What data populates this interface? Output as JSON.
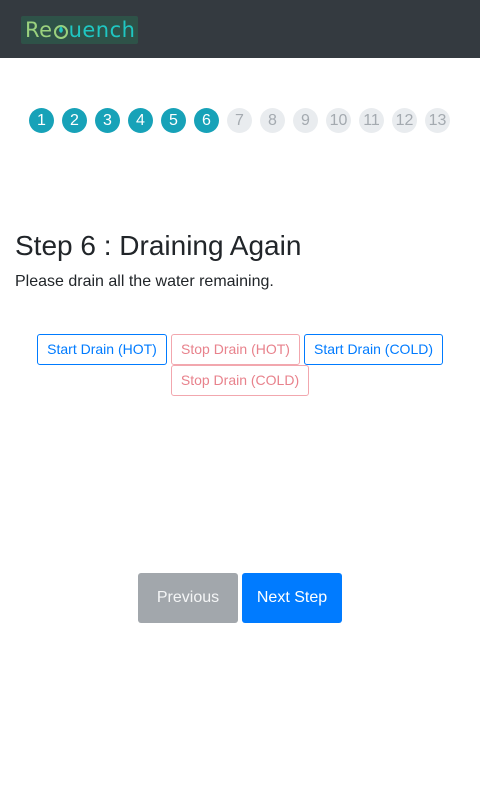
{
  "header": {
    "logo_text": "ReQuench"
  },
  "steps": [
    {
      "label": "1",
      "state": "done"
    },
    {
      "label": "2",
      "state": "done"
    },
    {
      "label": "3",
      "state": "done"
    },
    {
      "label": "4",
      "state": "done"
    },
    {
      "label": "5",
      "state": "done"
    },
    {
      "label": "6",
      "state": "current"
    },
    {
      "label": "7",
      "state": "todo"
    },
    {
      "label": "8",
      "state": "todo"
    },
    {
      "label": "9",
      "state": "todo"
    },
    {
      "label": "10",
      "state": "todo"
    },
    {
      "label": "11",
      "state": "todo"
    },
    {
      "label": "12",
      "state": "todo"
    },
    {
      "label": "13",
      "state": "todo"
    }
  ],
  "main": {
    "title": "Step 6 : Draining Again",
    "description": "Please drain all the water remaining."
  },
  "drain_buttons": {
    "start_hot": "Start Drain (HOT)",
    "stop_hot": "Stop Drain (HOT)",
    "start_cold": "Start Drain (COLD)",
    "stop_cold": "Stop Drain (COLD)"
  },
  "navigation": {
    "previous": "Previous",
    "next": "Next Step"
  },
  "colors": {
    "navbar": "#343a40",
    "step_done": "#17a2b8",
    "step_todo": "#e9ecef",
    "primary": "#007bff",
    "danger_light": "#f2a7ae",
    "secondary": "#a2a7ac"
  }
}
